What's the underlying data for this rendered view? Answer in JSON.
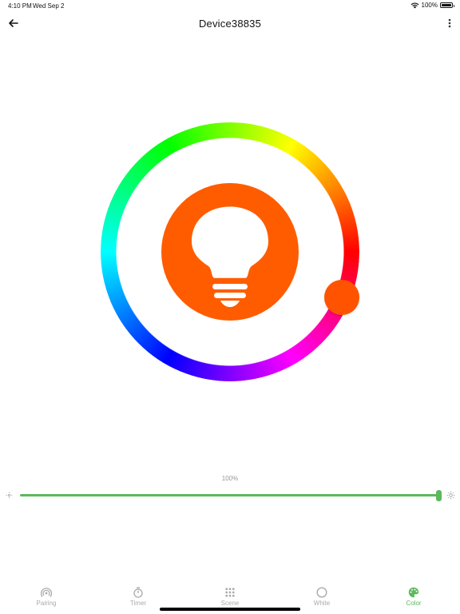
{
  "status_bar": {
    "time": "4:10 PM",
    "date": "Wed Sep 2",
    "battery": "100%"
  },
  "header": {
    "title": "Device38835",
    "back_icon": "arrow-left-icon",
    "more_icon": "more-vertical-icon"
  },
  "color_wheel": {
    "selected_color": "#ff5c00",
    "knob_color": "#ff5300"
  },
  "brightness": {
    "value_label": "100%",
    "level": 1.0,
    "track_color": "#5cb85c"
  },
  "tabs": [
    {
      "label": "Pairing",
      "icon": "pairing-icon",
      "active": false
    },
    {
      "label": "Timer",
      "icon": "timer-icon",
      "active": false
    },
    {
      "label": "Scene",
      "icon": "scene-grid-icon",
      "active": false
    },
    {
      "label": "White",
      "icon": "white-circle-icon",
      "active": false
    },
    {
      "label": "Color",
      "icon": "palette-icon",
      "active": true
    }
  ]
}
